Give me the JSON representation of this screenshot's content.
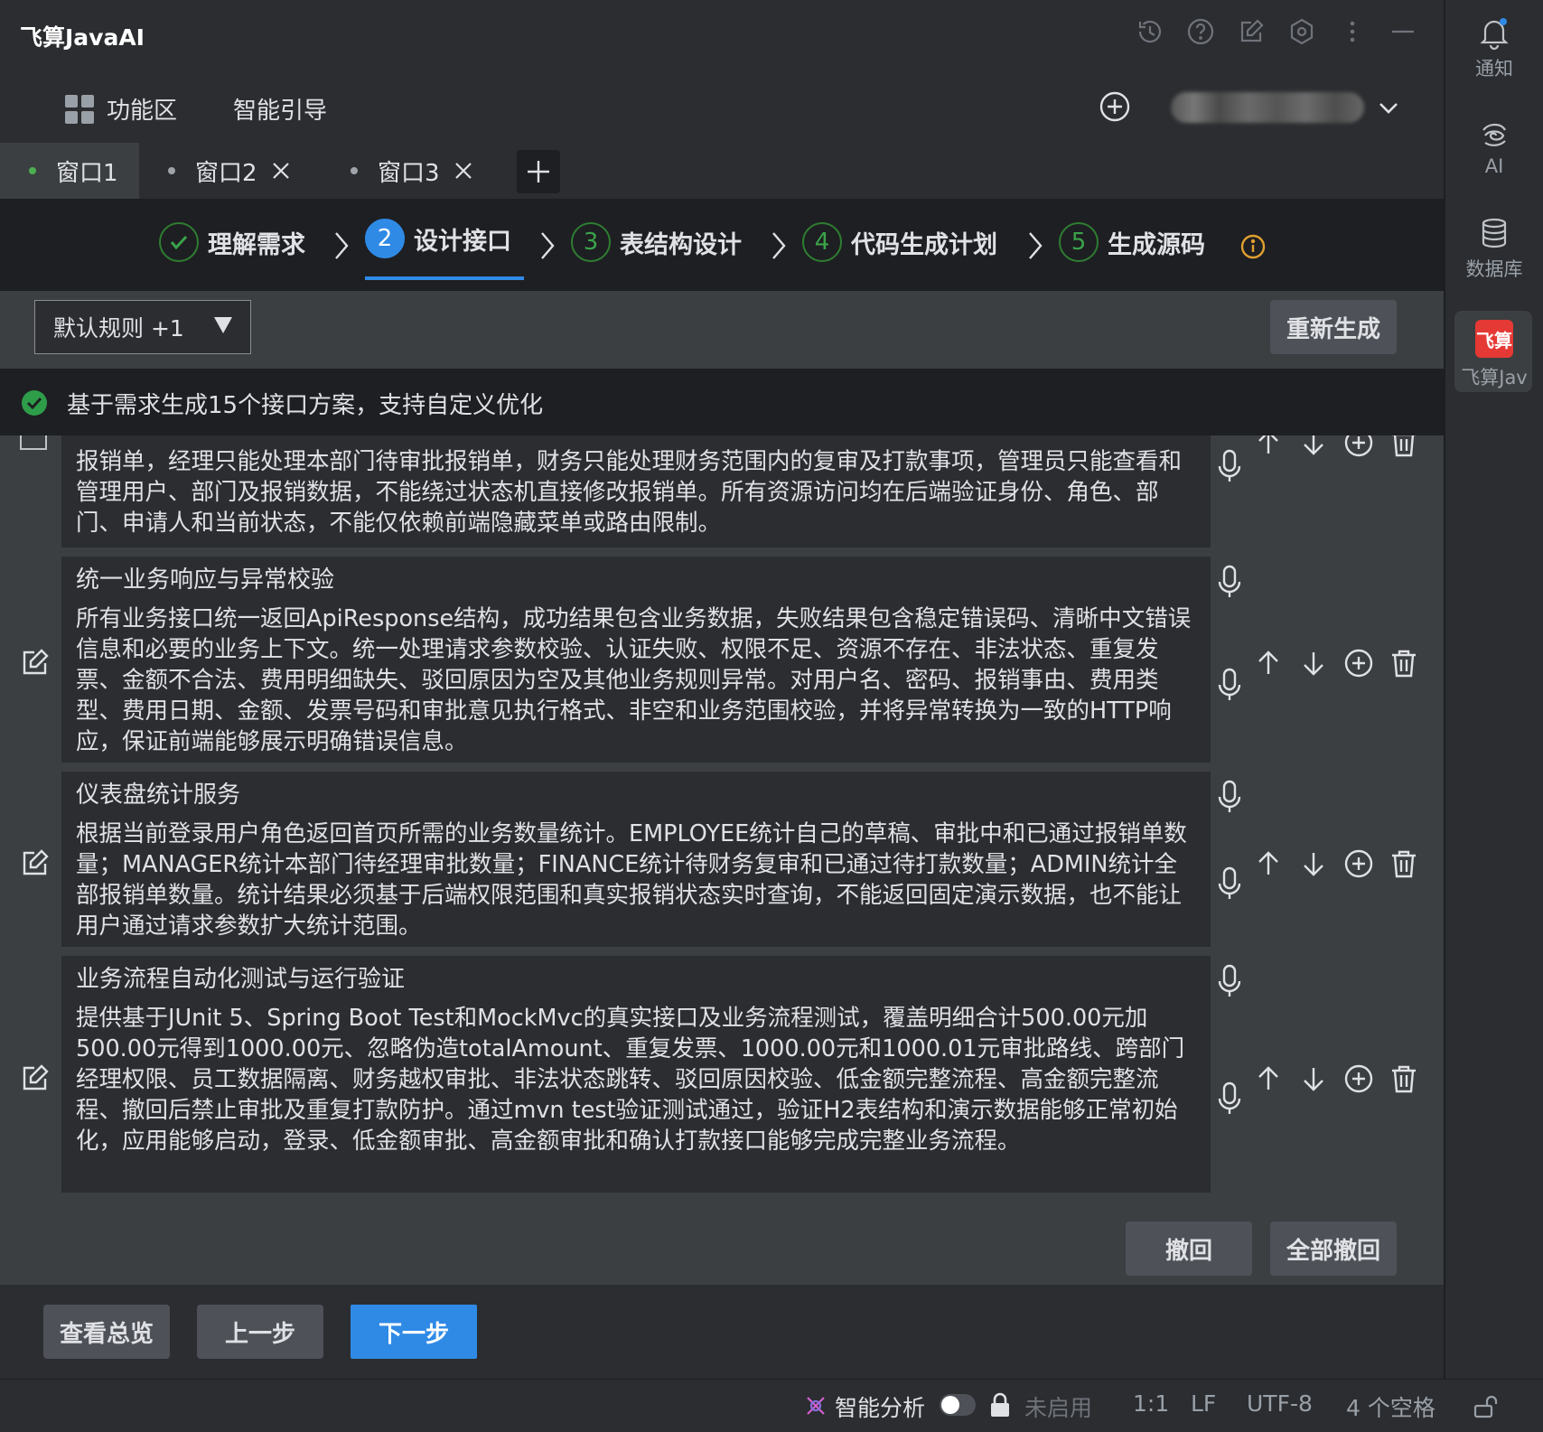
{
  "app": {
    "title": "飞算JavaAI"
  },
  "menu": {
    "function_area": "功能区",
    "smart_guide": "智能引导"
  },
  "tabs": [
    {
      "label": "窗口1"
    },
    {
      "label": "窗口2"
    },
    {
      "label": "窗口3"
    }
  ],
  "steps": [
    {
      "num": "",
      "label": "理解需求",
      "status": "done"
    },
    {
      "num": "2",
      "label": "设计接口",
      "status": "active"
    },
    {
      "num": "3",
      "label": "表结构设计",
      "status": "pending"
    },
    {
      "num": "4",
      "label": "代码生成计划",
      "status": "pending"
    },
    {
      "num": "5",
      "label": "生成源码",
      "status": "pending"
    }
  ],
  "toolbar": {
    "rule_select": "默认规则 +1",
    "regenerate": "重新生成"
  },
  "status": {
    "message": "基于需求生成15个接口方案，支持自定义优化"
  },
  "cards": [
    {
      "title": "",
      "body": "报销单，经理只能处理本部门待审批报销单，财务只能处理财务范围内的复审及打款事项，管理员只能查看和管理用户、部门及报销数据，不能绕过状态机直接修改报销单。所有资源访问均在后端验证身份、角色、部门、申请人和当前状态，不能仅依赖前端隐藏菜单或路由限制。"
    },
    {
      "title": "统一业务响应与异常校验",
      "body": "所有业务接口统一返回ApiResponse结构，成功结果包含业务数据，失败结果包含稳定错误码、清晰中文错误信息和必要的业务上下文。统一处理请求参数校验、认证失败、权限不足、资源不存在、非法状态、重复发票、金额不合法、费用明细缺失、驳回原因为空及其他业务规则异常。对用户名、密码、报销事由、费用类型、费用日期、金额、发票号码和审批意见执行格式、非空和业务范围校验，并将异常转换为一致的HTTP响应，保证前端能够展示明确错误信息。"
    },
    {
      "title": "仪表盘统计服务",
      "body": "根据当前登录用户角色返回首页所需的业务数量统计。EMPLOYEE统计自己的草稿、审批中和已通过报销单数量；MANAGER统计本部门待经理审批数量；FINANCE统计待财务复审和已通过待打款数量；ADMIN统计全部报销单数量。统计结果必须基于后端权限范围和真实报销状态实时查询，不能返回固定演示数据，也不能让用户通过请求参数扩大统计范围。"
    },
    {
      "title": "业务流程自动化测试与运行验证",
      "body": "提供基于JUnit 5、Spring Boot Test和MockMvc的真实接口及业务流程测试，覆盖明细合计500.00元加500.00元得到1000.00元、忽略伪造totalAmount、重复发票、1000.00元和1000.01元审批路线、跨部门经理权限、员工数据隔离、财务越权审批、非法状态跳转、驳回原因校验、低金额完整流程、高金额完整流程、撤回后禁止审批及重复打款防护。通过mvn test验证测试通过，验证H2表结构和演示数据能够正常初始化，应用能够启动，登录、低金额审批、高金额审批和确认打款接口能够完成完整业务流程。"
    }
  ],
  "undo": {
    "undo": "撤回",
    "undo_all": "全部撤回"
  },
  "nav": {
    "overview": "查看总览",
    "prev": "上一步",
    "next": "下一步"
  },
  "statusbar": {
    "smart_analysis": "智能分析",
    "disabled": "未启用",
    "position": "1:1",
    "line_ending": "LF",
    "encoding": "UTF-8",
    "indent": "4 个空格"
  },
  "rightbar": {
    "notify": "通知",
    "ai": "AI",
    "database": "数据库",
    "feisuan": "飞算Jav",
    "feisuan_logo": "飞算"
  },
  "colors": {
    "accent": "#2f8ae6",
    "success": "#2e9d4a",
    "warning": "#e0a030"
  }
}
